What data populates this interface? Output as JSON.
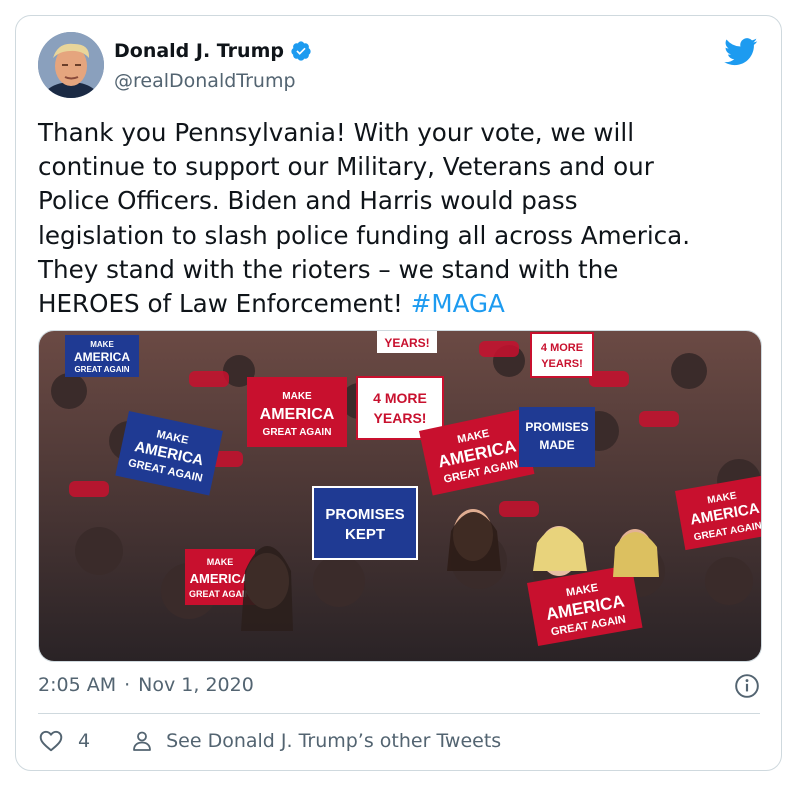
{
  "author": {
    "display_name": "Donald J. Trump",
    "handle": "@realDonaldTrump"
  },
  "tweet": {
    "text_lines": [
      "Thank you Pennsylvania! With your vote, we will",
      "continue to support our Military, Veterans and our",
      "Police Officers. Biden and Harris would pass",
      "legislation to slash police funding all across America.",
      "They stand with the rioters – we stand with the",
      "HEROES of Law Enforcement!"
    ],
    "hashtag": "#MAGA",
    "time": "2:05 AM",
    "separator": "·",
    "date": "Nov 1, 2020"
  },
  "media": {
    "signs": {
      "maga1": [
        "MAKE",
        "AMERICA",
        "GREAT AGAIN"
      ],
      "more_years": [
        "4 MORE",
        "YEARS!"
      ],
      "promises_kept": [
        "PROMISES",
        "KEPT"
      ],
      "promises_made": [
        "PROMISES",
        "MADE"
      ],
      "years": "YEARS!"
    }
  },
  "actions": {
    "like_count": "4",
    "other_tweets_label": "See Donald J. Trump’s other Tweets"
  },
  "colors": {
    "accent": "#1d9bf0",
    "text": "#0f1419",
    "muted": "#536471",
    "border": "#cfd9de",
    "sign_red": "#c8102e",
    "sign_blue": "#1f3a93"
  }
}
